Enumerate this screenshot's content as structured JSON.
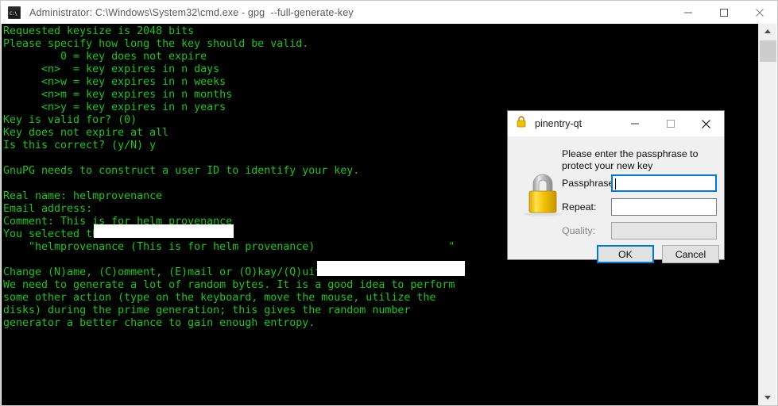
{
  "console_window": {
    "title": "Administrator: C:\\Windows\\System32\\cmd.exe - gpg  --full-generate-key",
    "icon_label": "C:\\",
    "icon_name": "cmd-console-icon",
    "controls": {
      "minimize": "Minimize",
      "maximize": "Maximize",
      "close": "Close"
    },
    "colors": {
      "background": "#000000",
      "text_green": "#19c819",
      "titlebar": "#ffffff",
      "titlebar_text": "#5a5a5a"
    }
  },
  "terminal": {
    "lines": [
      "Requested keysize is 2048 bits",
      "Please specify how long the key should be valid.",
      "         0 = key does not expire",
      "      <n>  = key expires in n days",
      "      <n>w = key expires in n weeks",
      "      <n>m = key expires in n months",
      "      <n>y = key expires in n years",
      "Key is valid for? (0)",
      "Key does not expire at all",
      "Is this correct? (y/N) y",
      "",
      "GnuPG needs to construct a user ID to identify your key.",
      "",
      "Real name: helmprovenance",
      "Email address:",
      "Comment: This is for helm provenance",
      "You selected this USER-ID:",
      "    \"helmprovenance (This is for helm provenance)                     \"",
      "",
      "Change (N)ame, (C)omment, (E)mail or (O)kay/(Q)uit? O",
      "We need to generate a lot of random bytes. It is a good idea to perform",
      "some other action (type on the keyboard, move the mouse, utilize the",
      "disks) during the prime generation; this gives the random number",
      "generator a better chance to gain enough entropy."
    ],
    "redactions": [
      {
        "name": "email-address-redaction"
      },
      {
        "name": "user-id-redaction"
      }
    ]
  },
  "scrollbar": {
    "up_arrow": "scroll-up-arrow-icon",
    "down_arrow": "scroll-down-arrow-icon",
    "thumb": "scrollbar-thumb"
  },
  "pinentry": {
    "title": "pinentry-qt",
    "lock_icon": "padlock-icon",
    "prompt": "Please enter the passphrase to protect your new key",
    "fields": [
      {
        "label": "Passphrase:",
        "value": "",
        "state": "focused"
      },
      {
        "label": "Repeat:",
        "value": "",
        "state": "enabled"
      },
      {
        "label": "Quality:",
        "value": "",
        "state": "disabled"
      }
    ],
    "buttons": {
      "ok": "OK",
      "cancel": "Cancel"
    },
    "controls": {
      "minimize": "Minimize",
      "maximize": "Maximize",
      "close": "Close"
    },
    "colors": {
      "accent": "#0078d7",
      "dialog_background": "#f0f0f0",
      "lock_gold": "#e8c020"
    }
  }
}
